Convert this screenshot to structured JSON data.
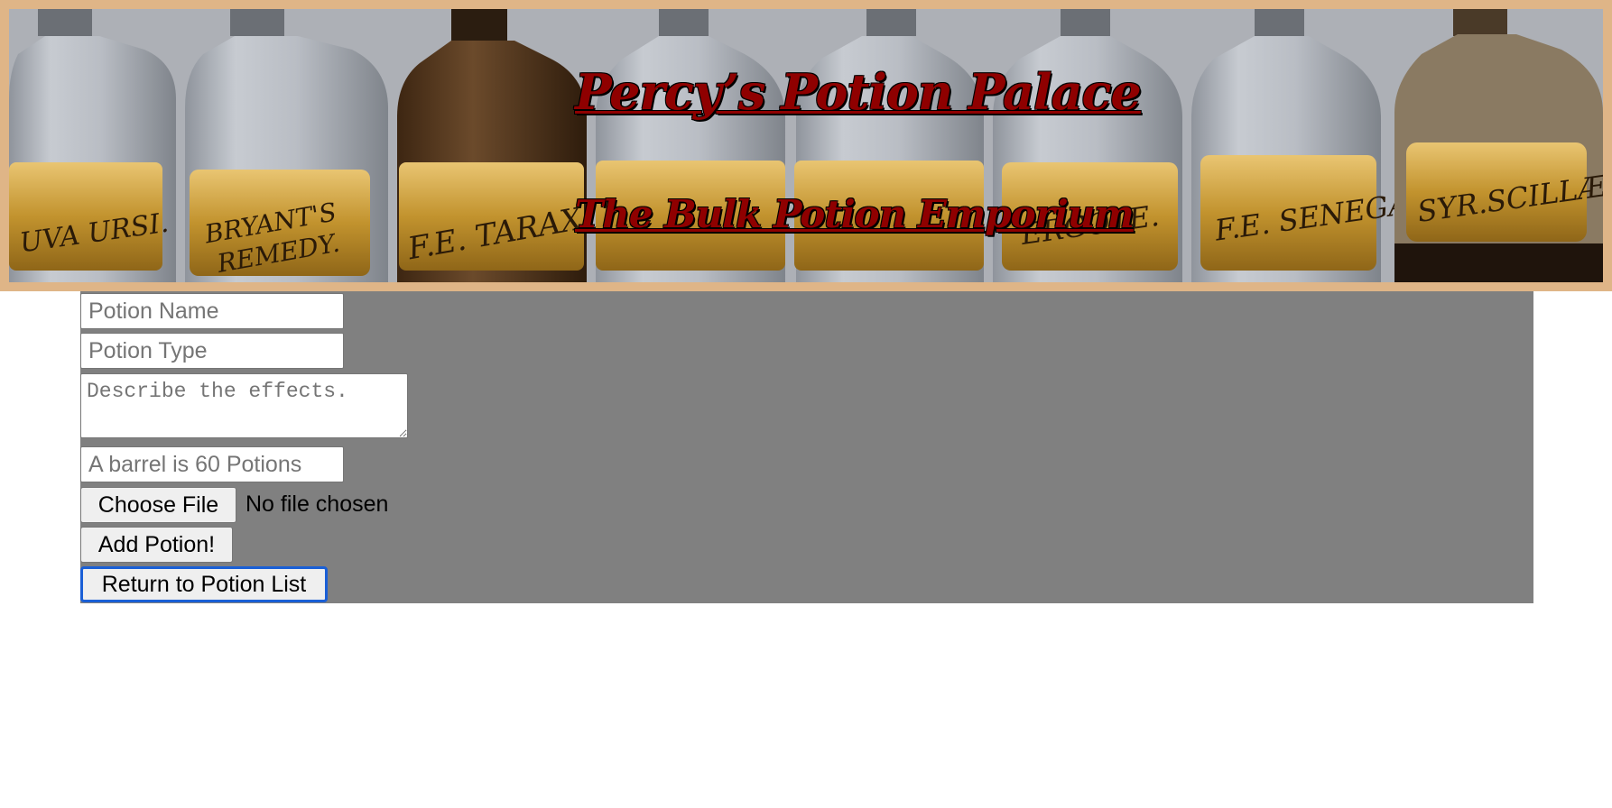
{
  "header": {
    "title": "Percy’s Potion Palace",
    "subtitle": "The Bulk Potion Emporium",
    "border_color": "#dfb587",
    "title_color": "#8f0000",
    "banner_image": "apothecary-bottles-photo",
    "bottle_labels": [
      "UVA URSI.",
      "BRYANT'S",
      "REMEDY.",
      "F.E. TARAX.",
      "ERGOTE.",
      "F.E. SENEGÆ.",
      "SYR.SCILLÆ"
    ]
  },
  "form": {
    "panel_color": "#808080",
    "name_placeholder": "Potion Name",
    "type_placeholder": "Potion Type",
    "effects_placeholder": "Describe the effects.",
    "quantity_placeholder": "A barrel is 60 Potions",
    "file_button_label": "Choose File",
    "file_status": "No file chosen",
    "add_button_label": "Add Potion!",
    "return_button_label": "Return to Potion List"
  }
}
